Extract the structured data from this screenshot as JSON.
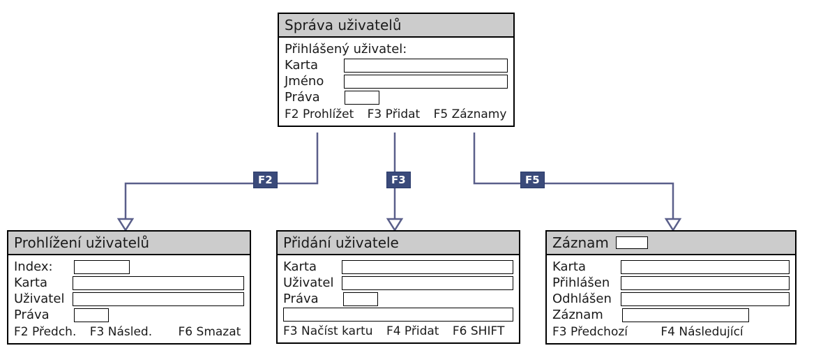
{
  "root": {
    "title": "Správa uživatelů",
    "subhead": "Přihlášený uživatel:",
    "fields": {
      "karta": "Karta",
      "jmeno": "Jméno",
      "prava": "Práva"
    },
    "footer": [
      "F2 Prohlížet",
      "F3 Přidat",
      "F5 Záznamy"
    ]
  },
  "edges": {
    "f2": "F2",
    "f3": "F3",
    "f5": "F5"
  },
  "browse": {
    "title": "Prohlížení uživatelů",
    "fields": {
      "index": "Index:",
      "karta": "Karta",
      "uzivatel": "Uživatel",
      "prava": "Práva"
    },
    "footer": [
      "F2 Předch.",
      "F3 Násled.",
      "F6 Smazat"
    ]
  },
  "add": {
    "title": "Přidání uživatele",
    "fields": {
      "karta": "Karta",
      "uzivatel": "Uživatel",
      "prava": "Práva"
    },
    "footer": [
      "F3 Načíst kartu",
      "F4 Přidat",
      "F6 SHIFT"
    ]
  },
  "record": {
    "title": "Záznam",
    "fields": {
      "karta": "Karta",
      "prihlasen": "Přihlášen",
      "odhlasen": "Odhlášen",
      "zaznam": "Záznam"
    },
    "footer": [
      "F3 Předchozí",
      "F4 Následující"
    ]
  }
}
